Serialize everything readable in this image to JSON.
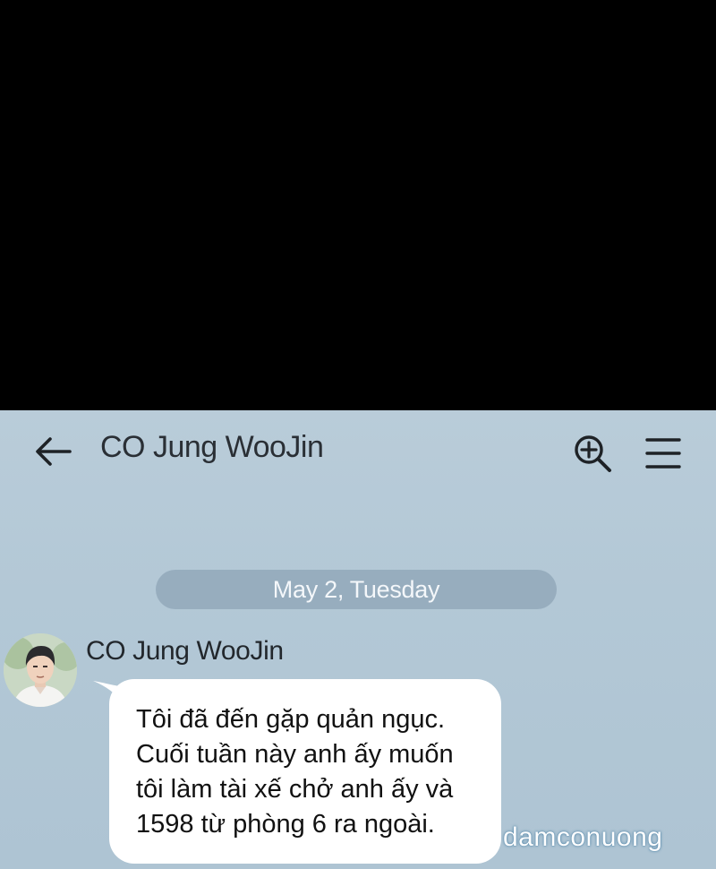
{
  "header": {
    "title": "CO Jung WooJin",
    "icons": {
      "back": "arrow-left-icon",
      "search": "zoom-in-icon",
      "menu": "hamburger-menu-icon"
    }
  },
  "conversation": {
    "date_separator": "May 2, Tuesday",
    "messages": [
      {
        "sender": "CO Jung WooJin",
        "lines": [
          "Tôi đã đến gặp quản ngục.",
          "Cuối tuần này anh ấy muốn",
          "tôi làm tài xế chở anh ấy và",
          "1598 từ phòng 6 ra ngoài."
        ]
      }
    ]
  },
  "watermark": "damconuong",
  "colors": {
    "background_top": "#000000",
    "chat_background": "#b5c9d7",
    "date_pill": "#97adbe",
    "bubble": "#ffffff",
    "text": "#2a2f35"
  }
}
